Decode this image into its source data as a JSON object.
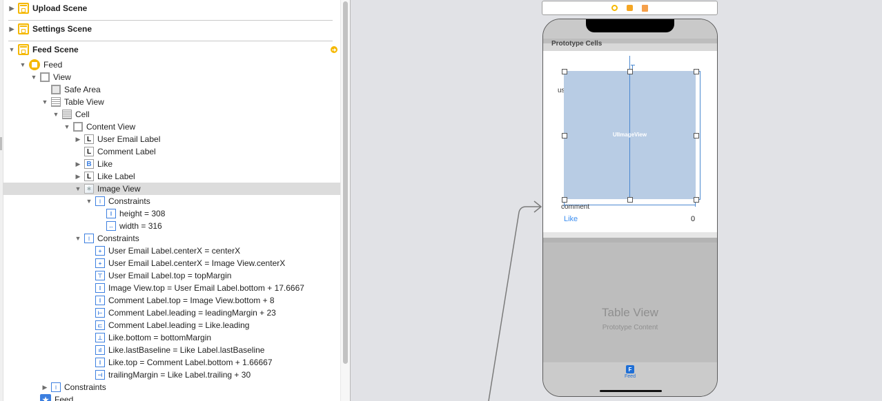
{
  "outline": {
    "scenes": [
      {
        "label": "Upload Scene",
        "expanded": false
      },
      {
        "label": "Settings Scene",
        "expanded": false
      },
      {
        "label": "Feed Scene",
        "expanded": true
      }
    ],
    "tree": [
      {
        "label": "Feed",
        "icon": "view-controller-icon"
      },
      {
        "label": "View",
        "icon": "view-icon"
      },
      {
        "label": "Safe Area",
        "icon": "safe-area-icon"
      },
      {
        "label": "Table View",
        "icon": "table-view-icon"
      },
      {
        "label": "Cell",
        "icon": "table-cell-icon"
      },
      {
        "label": "Content View",
        "icon": "view-icon"
      },
      {
        "label": "User Email Label",
        "icon": "label-icon",
        "glyph": "L"
      },
      {
        "label": "Comment Label",
        "icon": "label-icon",
        "glyph": "L"
      },
      {
        "label": "Like",
        "icon": "button-icon",
        "glyph": "B"
      },
      {
        "label": "Like Label",
        "icon": "label-icon",
        "glyph": "L"
      },
      {
        "label": "Image View",
        "icon": "image-view-icon"
      },
      {
        "label": "Constraints",
        "icon": "constraints-icon"
      },
      {
        "label": "height = 308",
        "icon": "height-constraint-icon"
      },
      {
        "label": "width = 316",
        "icon": "width-constraint-icon"
      },
      {
        "label": "Constraints",
        "icon": "constraints-icon"
      },
      {
        "label": "User Email Label.centerX = centerX",
        "icon": "center-x-constraint-icon"
      },
      {
        "label": "User Email Label.centerX = Image View.centerX",
        "icon": "center-x-constraint-icon"
      },
      {
        "label": "User Email Label.top = topMargin",
        "icon": "top-constraint-icon"
      },
      {
        "label": "Image View.top = User Email Label.bottom + 17.6667",
        "icon": "vertical-spacing-constraint-icon"
      },
      {
        "label": "Comment Label.top = Image View.bottom + 8",
        "icon": "vertical-spacing-constraint-icon"
      },
      {
        "label": "Comment Label.leading = leadingMargin + 23",
        "icon": "leading-constraint-icon"
      },
      {
        "label": "Comment Label.leading = Like.leading",
        "icon": "leading-align-constraint-icon"
      },
      {
        "label": "Like.bottom = bottomMargin",
        "icon": "bottom-constraint-icon"
      },
      {
        "label": "Like.lastBaseline = Like Label.lastBaseline",
        "icon": "baseline-constraint-icon"
      },
      {
        "label": "Like.top = Comment Label.bottom + 1.66667",
        "icon": "vertical-spacing-constraint-icon"
      },
      {
        "label": "trailingMargin = Like Label.trailing + 30",
        "icon": "trailing-constraint-icon"
      },
      {
        "label": "Constraints",
        "icon": "constraints-icon"
      },
      {
        "label": "Feed",
        "icon": "tab-bar-item-icon"
      }
    ],
    "selected": "Image View"
  },
  "canvas": {
    "section_header": "Prototype Cells",
    "cell": {
      "user_email": "user email",
      "image_view_label": "UIImageView",
      "comment": "comment",
      "like_button": "Like",
      "like_count": "0"
    },
    "table_view_title": "Table View",
    "table_view_subtitle": "Prototype Content",
    "tab_item": {
      "glyph": "F",
      "label": "Feed"
    }
  },
  "colors": {
    "accent_blue": "#3c7fe0",
    "scene_yellow": "#f5b800",
    "image_view_fill": "#b8cce4",
    "selection_bg": "#dcdcdc"
  }
}
